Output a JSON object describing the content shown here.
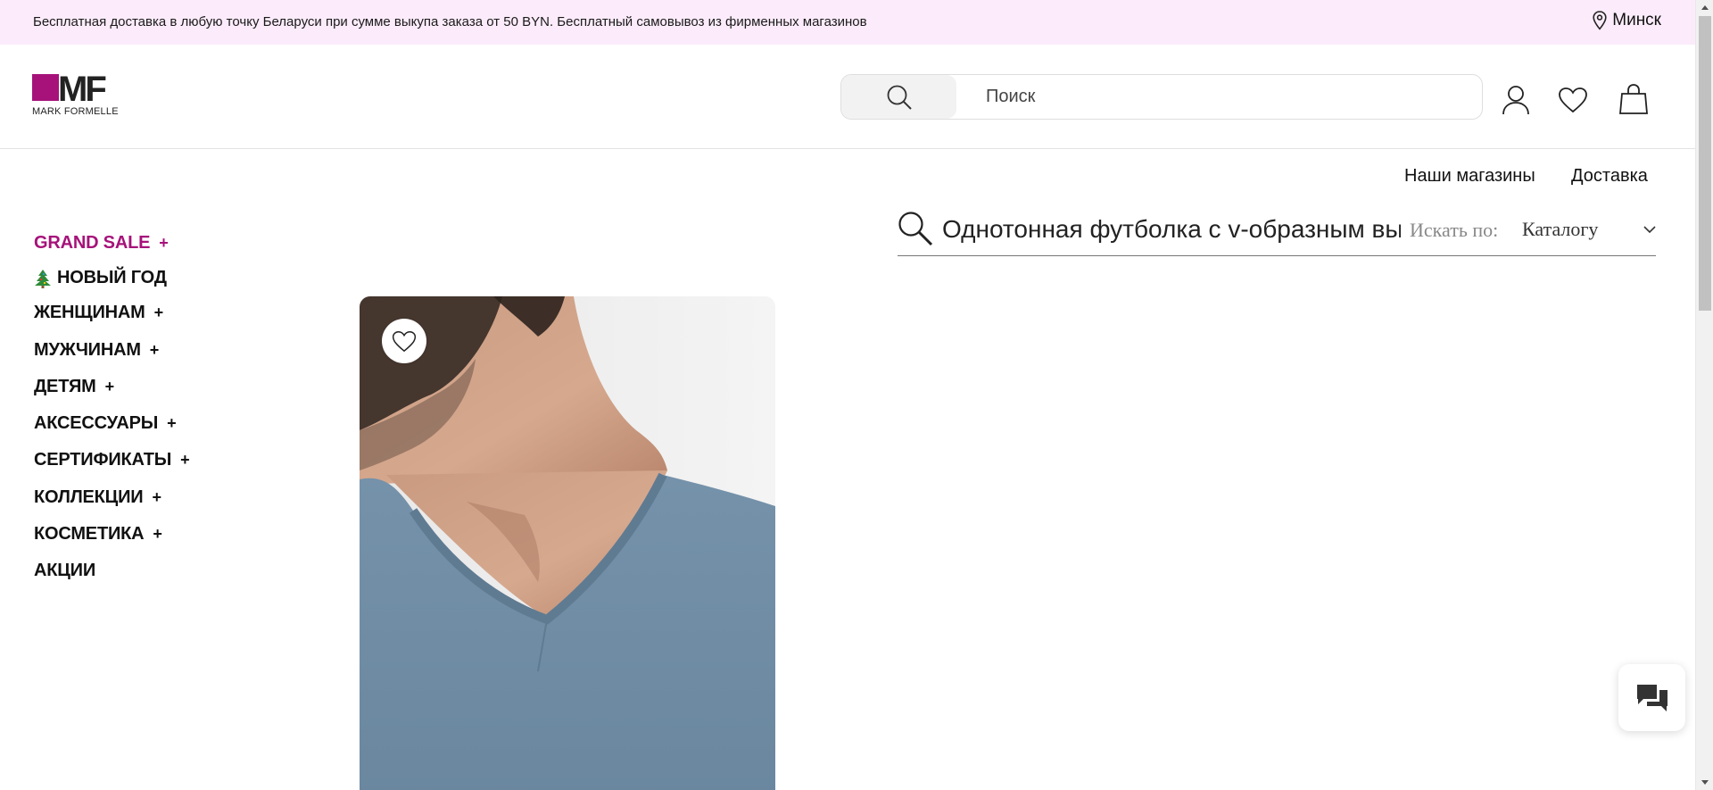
{
  "promo": {
    "text": "Бесплатная доставка в любую точку Беларуси при сумме выкупа заказа от 50 BYN. Бесплатный самовывоз из фирменных магазинов",
    "city": "Минск"
  },
  "logo": {
    "mark": "MF",
    "name": "MARK FORMELLE",
    "brand_color": "#a6127a"
  },
  "search": {
    "placeholder": "Поиск",
    "value": ""
  },
  "subnav": {
    "stores": "Наши магазины",
    "delivery": "Доставка"
  },
  "categories": [
    {
      "label": "GRAND SALE",
      "plus": "+"
    },
    {
      "label": "НОВЫЙ ГОД",
      "icon": "christmas-tree-icon"
    },
    {
      "label": "ЖЕНЩИНАМ",
      "plus": "+"
    },
    {
      "label": "МУЖЧИНАМ",
      "plus": "+"
    },
    {
      "label": "ДЕТЯМ",
      "plus": "+"
    },
    {
      "label": "АКСЕССУАРЫ",
      "plus": "+"
    },
    {
      "label": "СЕРТИФИКАТЫ",
      "plus": "+"
    },
    {
      "label": "КОЛЛЕКЦИИ",
      "plus": "+"
    },
    {
      "label": "КОСМЕТИКА",
      "plus": "+"
    },
    {
      "label": "АКЦИИ"
    }
  ],
  "catalog_search": {
    "query": "Однотонная футболка с v-образным вырезом",
    "search_by_label": "Искать по:",
    "search_by_value": "Каталогу"
  },
  "colors": {
    "promo_bg": "#fcecfb",
    "accent": "#a6127a",
    "shirt": "#6f8ca4"
  }
}
